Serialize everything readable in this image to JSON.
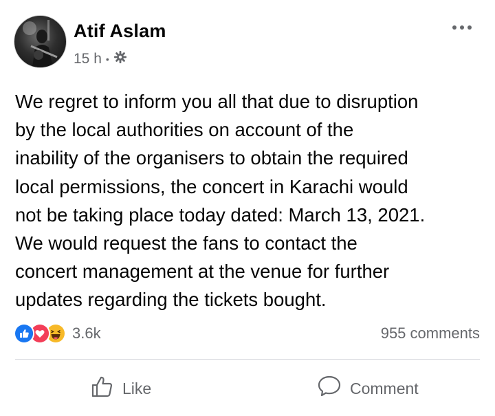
{
  "post": {
    "author": "Atif Aslam",
    "time": "15 h",
    "privacy_icon": "gear-icon",
    "text_lines": [
      "We regret to inform you all that due to disruption",
      "by the local authorities on account of the",
      "inability of the organisers to obtain the required",
      "local permissions, the concert in Karachi would",
      "not be taking place today dated: March 13, 2021.",
      "We would request the fans to contact the",
      "concert management at the venue for further",
      "updates regarding the tickets bought."
    ]
  },
  "stats": {
    "reactions_count": "3.6k",
    "reaction_icons": [
      "like-icon",
      "love-icon",
      "haha-icon"
    ],
    "comments": "955 comments"
  },
  "actions": {
    "like": "Like",
    "comment": "Comment"
  },
  "colors": {
    "secondary_text": "#65676b",
    "like_blue": "#1877f2",
    "love_red": "#f33e58",
    "haha_yellow": "#f7b928"
  }
}
